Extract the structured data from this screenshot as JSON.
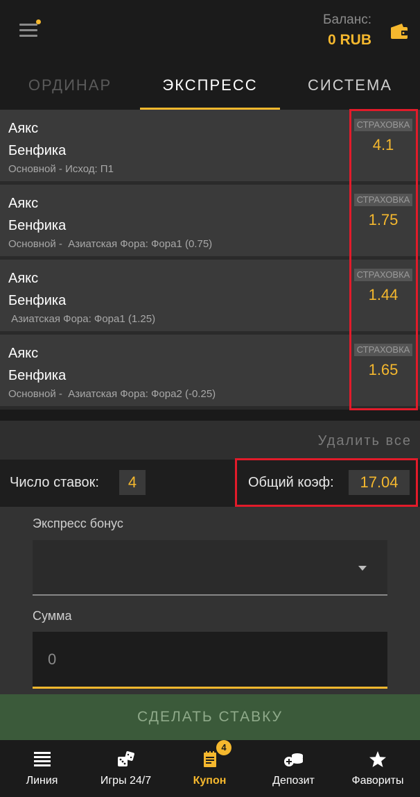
{
  "header": {
    "balance_label": "Баланс:",
    "balance_value": "0 RUB"
  },
  "tabs": [
    {
      "label": "ОРДИНАР",
      "active": false
    },
    {
      "label": "ЭКСПРЕСС",
      "active": true
    },
    {
      "label": "СИСТЕМА",
      "active": false
    }
  ],
  "bets": [
    {
      "team1": "Аякс",
      "team2": "Бенфика",
      "market": "Основной - Исход: П1",
      "insurance": "СТРАХОВКА",
      "odds": "4.1"
    },
    {
      "team1": "Аякс",
      "team2": "Бенфика",
      "market": "Основной -  Азиатская Фора: Фора1 (0.75)",
      "insurance": "СТРАХОВКА",
      "odds": "1.75"
    },
    {
      "team1": "Аякс",
      "team2": "Бенфика",
      "market": " Азиатская Фора: Фора1 (1.25)",
      "insurance": "СТРАХОВКА",
      "odds": "1.44"
    },
    {
      "team1": "Аякс",
      "team2": "Бенфика",
      "market": "Основной -  Азиатская Фора: Фора2 (-0.25)",
      "insurance": "СТРАХОВКА",
      "odds": "1.65"
    }
  ],
  "delete_all": "Удалить все",
  "summary": {
    "count_label": "Число ставок:",
    "count_value": "4",
    "total_label": "Общий коэф:",
    "total_value": "17.04"
  },
  "form": {
    "bonus_label": "Экспресс бонус",
    "bonus_value": "",
    "sum_label": "Сумма",
    "sum_placeholder": "0"
  },
  "place_bet": "СДЕЛАТЬ СТАВКУ",
  "nav": {
    "items": [
      {
        "label": "Линия",
        "icon": "list-icon"
      },
      {
        "label": "Игры 24/7",
        "icon": "dice-icon"
      },
      {
        "label": "Купон",
        "icon": "coupon-icon",
        "active": true
      },
      {
        "label": "Депозит",
        "icon": "coins-plus-icon"
      },
      {
        "label": "Фавориты",
        "icon": "star-icon"
      }
    ],
    "coupon_badge": "4"
  },
  "colors": {
    "accent": "#f5b82e",
    "highlight_box": "#e21b2a",
    "place_bet_bg": "#3b5a3a"
  }
}
